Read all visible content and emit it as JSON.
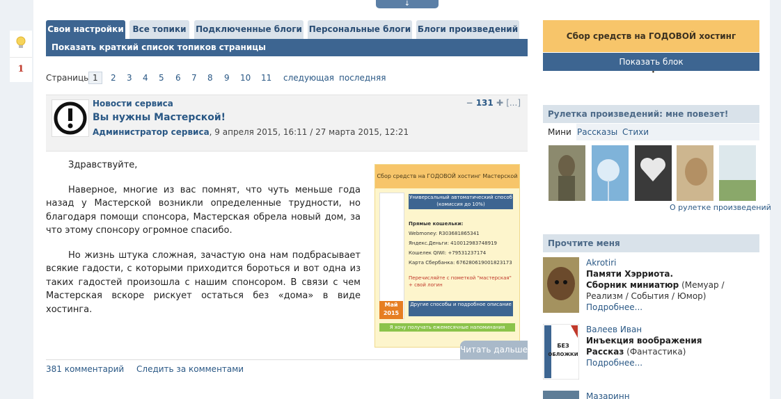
{
  "topbar": {
    "arrow": "↓"
  },
  "left": {
    "notification_count": "1"
  },
  "tabs": [
    "Свои настройки",
    "Все топики",
    "Подключенные блоги",
    "Персональные блоги",
    "Блоги произведений"
  ],
  "subtab": "Показать краткий список топиков страницы",
  "pager": {
    "label": "Страницы:",
    "pages": [
      "1",
      "2",
      "3",
      "4",
      "5",
      "6",
      "7",
      "8",
      "9",
      "10",
      "11"
    ],
    "current": "1",
    "next": "следующая",
    "last": "последняя"
  },
  "post": {
    "category": "Новости сервиса",
    "title": "Вы нужны Мастерской!",
    "author": "Администратор сервиса",
    "dates": ", 9 апреля 2015, 16:11 / 27 марта 2015, 12:21",
    "rating_minus": "−",
    "rating": "131",
    "rating_plus": "✚",
    "more": "[...]",
    "paragraphs": [
      "Здравствуйте,",
      "Наверное, многие из вас помнят, что чуть меньше года назад у Мастерской возникли определенные трудности, но благодаря помощи спонсора, Мастерская обрела новый дом, за что этому спонсору огромное спасибо.",
      "Но жизнь штука сложная, зачастую она нам подбрасывает всякие гадости, с которыми приходится бороться и вот одна из таких гадостей произошла с нашим спонсором. В связи с чем Мастерская вскоре рискует остаться без «дома» в виде хостинга."
    ],
    "banner": {
      "title": "Сбор средств на ГОДОВОЙ хостинг Мастерской",
      "button1": "Универсальный автоматический способ (комиссия до 10%)",
      "wallets_title": "Прямые кошельки:",
      "wallets": [
        "Webmoney: R303681865341",
        "Яндекс.Деньги: 410012983748919",
        "Кошелек QIWI: +79531237174",
        "Карта Сбербанка: 676280619001823173"
      ],
      "note": "Перечисляйте с пометкой \"мастерская\" + свой логин",
      "month": "Май",
      "year": "2015",
      "button2": "Другие способы и подробное описание",
      "button3": "Я хочу получать ежемесячные напоминания"
    },
    "read_more": "Читать дальше",
    "comments": "381 комментарий",
    "follow": "Следить за комментами"
  },
  "sidebar": {
    "fund_title": "Сбор средств на ГОДОВОЙ хостинг Мастерской",
    "fund_button": "Показать блок",
    "roulette_title": "Рулетка произведений: мне повезет!",
    "roulette_tabs": [
      "Мини",
      "Рассказы",
      "Стихи"
    ],
    "roulette_link": "О рулетке произведений",
    "read_title": "Прочтите меня",
    "items": [
      {
        "author": "Akrotiri",
        "title": "Памяти Хэрриота.",
        "title2": "Сборник миниатюр",
        "genre": " (Мемуар / Реализм / События / Юмор)",
        "more": "Подробнее..."
      },
      {
        "author": "Валеев Иван",
        "title": "Инъекция воображения",
        "title2": "Рассказ",
        "genre": " (Фантастика)",
        "more": "Подробнее..."
      },
      {
        "author": "Мазаринн"
      }
    ],
    "no_cover": "БЕЗ ОБЛОЖКИ"
  }
}
